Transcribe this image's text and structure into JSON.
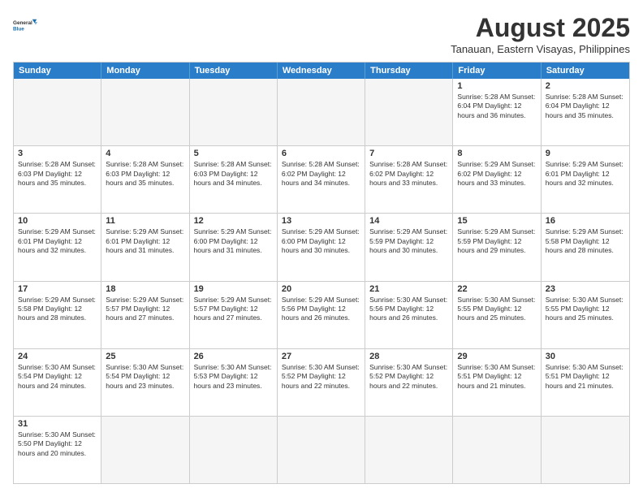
{
  "logo": {
    "line1": "General",
    "line2": "Blue"
  },
  "title": "August 2025",
  "subtitle": "Tanauan, Eastern Visayas, Philippines",
  "days_of_week": [
    "Sunday",
    "Monday",
    "Tuesday",
    "Wednesday",
    "Thursday",
    "Friday",
    "Saturday"
  ],
  "weeks": [
    [
      {
        "day": "",
        "info": ""
      },
      {
        "day": "",
        "info": ""
      },
      {
        "day": "",
        "info": ""
      },
      {
        "day": "",
        "info": ""
      },
      {
        "day": "",
        "info": ""
      },
      {
        "day": "1",
        "info": "Sunrise: 5:28 AM\nSunset: 6:04 PM\nDaylight: 12 hours and 36 minutes."
      },
      {
        "day": "2",
        "info": "Sunrise: 5:28 AM\nSunset: 6:04 PM\nDaylight: 12 hours and 35 minutes."
      }
    ],
    [
      {
        "day": "3",
        "info": "Sunrise: 5:28 AM\nSunset: 6:03 PM\nDaylight: 12 hours and 35 minutes."
      },
      {
        "day": "4",
        "info": "Sunrise: 5:28 AM\nSunset: 6:03 PM\nDaylight: 12 hours and 35 minutes."
      },
      {
        "day": "5",
        "info": "Sunrise: 5:28 AM\nSunset: 6:03 PM\nDaylight: 12 hours and 34 minutes."
      },
      {
        "day": "6",
        "info": "Sunrise: 5:28 AM\nSunset: 6:02 PM\nDaylight: 12 hours and 34 minutes."
      },
      {
        "day": "7",
        "info": "Sunrise: 5:28 AM\nSunset: 6:02 PM\nDaylight: 12 hours and 33 minutes."
      },
      {
        "day": "8",
        "info": "Sunrise: 5:29 AM\nSunset: 6:02 PM\nDaylight: 12 hours and 33 minutes."
      },
      {
        "day": "9",
        "info": "Sunrise: 5:29 AM\nSunset: 6:01 PM\nDaylight: 12 hours and 32 minutes."
      }
    ],
    [
      {
        "day": "10",
        "info": "Sunrise: 5:29 AM\nSunset: 6:01 PM\nDaylight: 12 hours and 32 minutes."
      },
      {
        "day": "11",
        "info": "Sunrise: 5:29 AM\nSunset: 6:01 PM\nDaylight: 12 hours and 31 minutes."
      },
      {
        "day": "12",
        "info": "Sunrise: 5:29 AM\nSunset: 6:00 PM\nDaylight: 12 hours and 31 minutes."
      },
      {
        "day": "13",
        "info": "Sunrise: 5:29 AM\nSunset: 6:00 PM\nDaylight: 12 hours and 30 minutes."
      },
      {
        "day": "14",
        "info": "Sunrise: 5:29 AM\nSunset: 5:59 PM\nDaylight: 12 hours and 30 minutes."
      },
      {
        "day": "15",
        "info": "Sunrise: 5:29 AM\nSunset: 5:59 PM\nDaylight: 12 hours and 29 minutes."
      },
      {
        "day": "16",
        "info": "Sunrise: 5:29 AM\nSunset: 5:58 PM\nDaylight: 12 hours and 28 minutes."
      }
    ],
    [
      {
        "day": "17",
        "info": "Sunrise: 5:29 AM\nSunset: 5:58 PM\nDaylight: 12 hours and 28 minutes."
      },
      {
        "day": "18",
        "info": "Sunrise: 5:29 AM\nSunset: 5:57 PM\nDaylight: 12 hours and 27 minutes."
      },
      {
        "day": "19",
        "info": "Sunrise: 5:29 AM\nSunset: 5:57 PM\nDaylight: 12 hours and 27 minutes."
      },
      {
        "day": "20",
        "info": "Sunrise: 5:29 AM\nSunset: 5:56 PM\nDaylight: 12 hours and 26 minutes."
      },
      {
        "day": "21",
        "info": "Sunrise: 5:30 AM\nSunset: 5:56 PM\nDaylight: 12 hours and 26 minutes."
      },
      {
        "day": "22",
        "info": "Sunrise: 5:30 AM\nSunset: 5:55 PM\nDaylight: 12 hours and 25 minutes."
      },
      {
        "day": "23",
        "info": "Sunrise: 5:30 AM\nSunset: 5:55 PM\nDaylight: 12 hours and 25 minutes."
      }
    ],
    [
      {
        "day": "24",
        "info": "Sunrise: 5:30 AM\nSunset: 5:54 PM\nDaylight: 12 hours and 24 minutes."
      },
      {
        "day": "25",
        "info": "Sunrise: 5:30 AM\nSunset: 5:54 PM\nDaylight: 12 hours and 23 minutes."
      },
      {
        "day": "26",
        "info": "Sunrise: 5:30 AM\nSunset: 5:53 PM\nDaylight: 12 hours and 23 minutes."
      },
      {
        "day": "27",
        "info": "Sunrise: 5:30 AM\nSunset: 5:52 PM\nDaylight: 12 hours and 22 minutes."
      },
      {
        "day": "28",
        "info": "Sunrise: 5:30 AM\nSunset: 5:52 PM\nDaylight: 12 hours and 22 minutes."
      },
      {
        "day": "29",
        "info": "Sunrise: 5:30 AM\nSunset: 5:51 PM\nDaylight: 12 hours and 21 minutes."
      },
      {
        "day": "30",
        "info": "Sunrise: 5:30 AM\nSunset: 5:51 PM\nDaylight: 12 hours and 21 minutes."
      }
    ],
    [
      {
        "day": "31",
        "info": "Sunrise: 5:30 AM\nSunset: 5:50 PM\nDaylight: 12 hours and 20 minutes."
      },
      {
        "day": "",
        "info": ""
      },
      {
        "day": "",
        "info": ""
      },
      {
        "day": "",
        "info": ""
      },
      {
        "day": "",
        "info": ""
      },
      {
        "day": "",
        "info": ""
      },
      {
        "day": "",
        "info": ""
      }
    ]
  ]
}
